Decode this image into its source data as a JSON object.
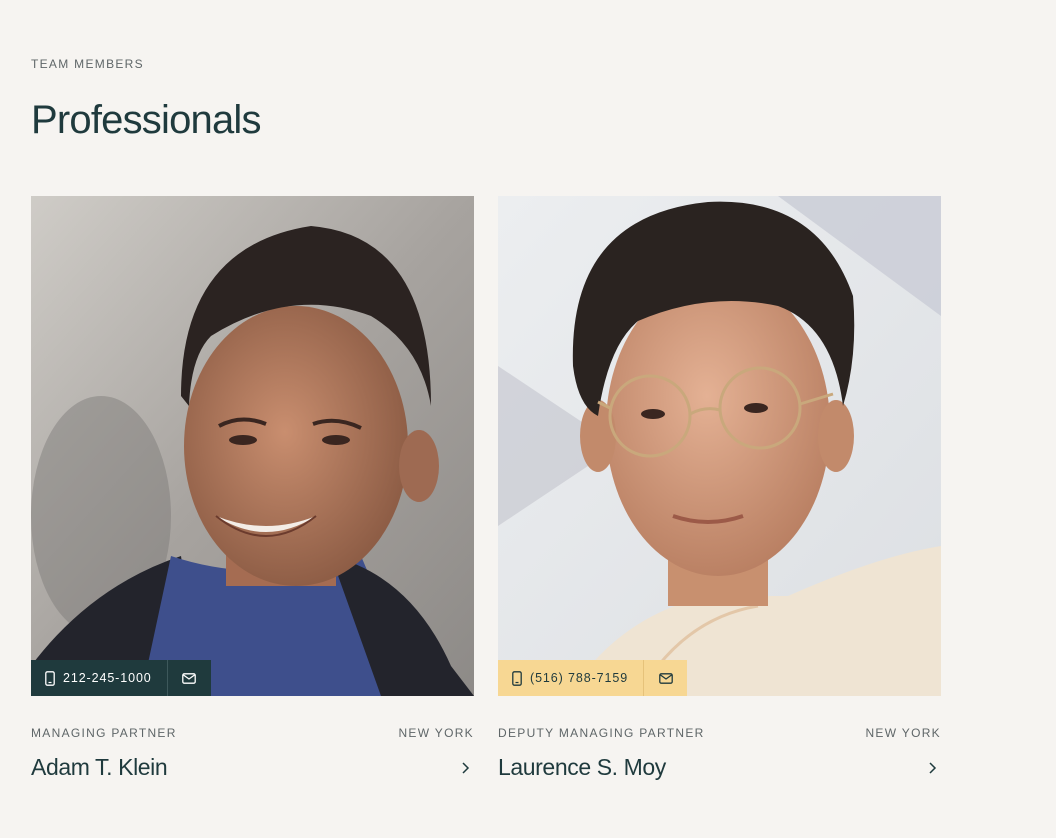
{
  "section": {
    "eyebrow": "TEAM MEMBERS",
    "title": "Professionals"
  },
  "members": [
    {
      "role": "MANAGING PARTNER",
      "location": "NEW YORK",
      "name": "Adam T. Klein",
      "phone": "212-245-1000",
      "contact_style": "dark",
      "contact_bg": "#1f3a3d"
    },
    {
      "role": "DEPUTY MANAGING PARTNER",
      "location": "NEW YORK",
      "name": "Laurence S. Moy",
      "phone": "(516) 788-7159",
      "contact_style": "light",
      "contact_bg": "#f7d793"
    }
  ],
  "icons": {
    "phone": "phone-icon",
    "mail": "mail-icon",
    "arrow": "chevron-right-icon"
  },
  "colors": {
    "background": "#f6f4f1",
    "heading": "#1f3a3d",
    "muted": "#5f6668"
  }
}
